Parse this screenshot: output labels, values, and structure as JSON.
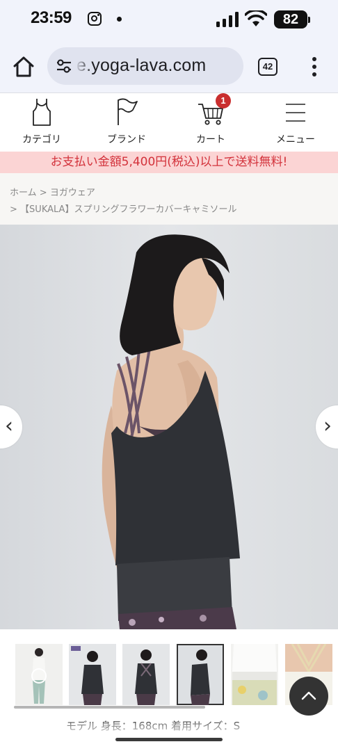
{
  "status_bar": {
    "time": "23:59",
    "battery": "82",
    "icons": [
      "instagram-icon",
      "dot-icon",
      "signal-icon",
      "wifi-icon",
      "battery-icon"
    ]
  },
  "browser": {
    "url": "e.yoga-lava.com",
    "tab_count": "42",
    "icons": [
      "home-icon",
      "site-settings-icon",
      "tab-switcher-icon",
      "more-menu-icon"
    ]
  },
  "nav": {
    "items": [
      {
        "label": "カテゴリ",
        "icon": "tank-top-icon"
      },
      {
        "label": "ブランド",
        "icon": "flag-icon"
      },
      {
        "label": "カート",
        "icon": "cart-icon"
      },
      {
        "label": "メニュー",
        "icon": "hamburger-menu-icon"
      }
    ],
    "cart_count": "1"
  },
  "promo": {
    "text": "お支払い金額5,400円(税込)以上で送料無料!",
    "color": "#d3323b",
    "background": "#fbd4d4"
  },
  "breadcrumb": {
    "home": "ホーム",
    "sep1": ">",
    "category": "ヨガウェア",
    "sep2": ">",
    "current": "【SUKALA】スプリングフラワーカバーキャミソール"
  },
  "slider": {
    "prev": "‹",
    "next": "›",
    "thumb_count": 6,
    "active_thumb": 4
  },
  "model_info": "モデル 身長：168cm 着用サイズ：S",
  "colors": {
    "accent": "#c92e2e",
    "cami": "#2f3136"
  }
}
